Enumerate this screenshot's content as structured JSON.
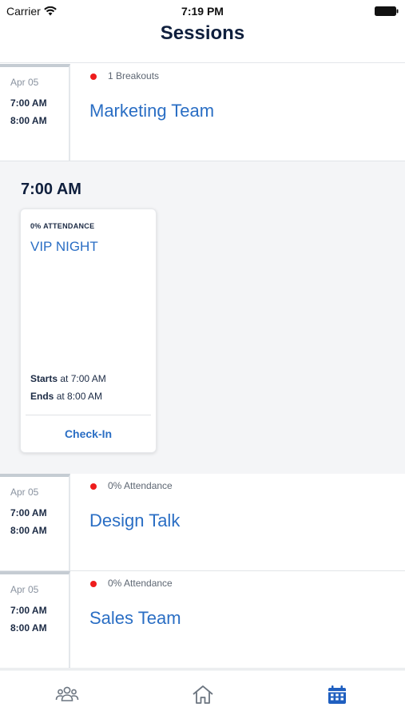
{
  "status_bar": {
    "carrier": "Carrier",
    "time": "7:19 PM",
    "wifi_icon": "wifi-icon",
    "battery_icon": "battery-icon"
  },
  "header": {
    "title": "Sessions"
  },
  "sessions": [
    {
      "date": "Apr 05",
      "start": "7:00 AM",
      "end": "8:00 AM",
      "status": "1 Breakouts",
      "title": "Marketing Team"
    },
    {
      "date": "Apr 05",
      "start": "7:00 AM",
      "end": "8:00 AM",
      "status": "0% Attendance",
      "title": "Design Talk"
    },
    {
      "date": "Apr 05",
      "start": "7:00 AM",
      "end": "8:00 AM",
      "status": "0% Attendance",
      "title": "Sales Team"
    }
  ],
  "expanded": {
    "time": "7:00 AM",
    "card": {
      "attendance": "0% ATTENDANCE",
      "title": "VIP NIGHT",
      "starts_label": "Starts",
      "starts_value": "at 7:00 AM",
      "ends_label": "Ends",
      "ends_value": "at 8:00 AM",
      "checkin_label": "Check-In"
    }
  },
  "tabs": [
    {
      "icon": "people-icon",
      "active": false
    },
    {
      "icon": "home-icon",
      "active": false
    },
    {
      "icon": "calendar-icon",
      "active": true
    }
  ],
  "colors": {
    "accent": "#2a6ec4",
    "status_dot": "#ee1c1c",
    "active_tab": "#1f5fc0",
    "inactive_tab": "#6c7580",
    "title": "#0f1f3d"
  }
}
